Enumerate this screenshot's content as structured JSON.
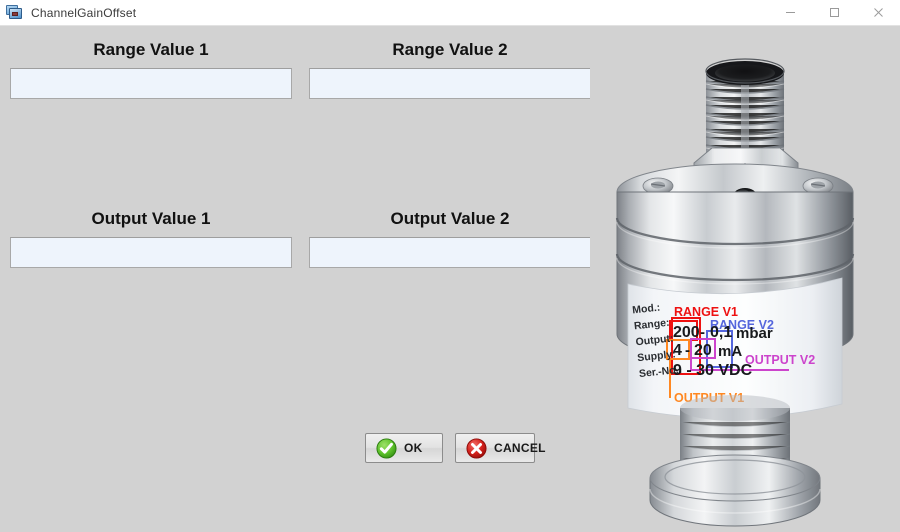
{
  "window": {
    "title": "ChannelGainOffset",
    "icon": "computer-monitor-icon",
    "minimize_label": "Minimize",
    "maximize_label": "Maximize",
    "close_label": "Close"
  },
  "form": {
    "fields": [
      {
        "label": "Range Value 1",
        "value": "",
        "placeholder": ""
      },
      {
        "label": "Range Value 2",
        "value": "",
        "placeholder": ""
      },
      {
        "label": "Output Value 1",
        "value": "",
        "placeholder": ""
      },
      {
        "label": "Output Value 2",
        "value": "",
        "placeholder": ""
      }
    ]
  },
  "buttons": {
    "ok": "OK",
    "cancel": "CANCEL"
  },
  "sensor_label": {
    "rows": [
      {
        "key": "Mod.:",
        "value": ""
      },
      {
        "key": "Range:",
        "value": "200 - 0,1 mbar"
      },
      {
        "key": "Output:",
        "value": "4 - 20 mA"
      },
      {
        "key": "Supply:",
        "value": "9 - 30 VDC"
      },
      {
        "key": "Ser.-No.:",
        "value": ""
      }
    ],
    "range_v1_value": "200",
    "range_v2_value": "0,1",
    "range_unit": "mbar",
    "output_v1_value": "4",
    "output_v2_value": "20",
    "output_unit": "mA",
    "supply_value": "9 - 30 VDC",
    "separator": "-",
    "annotations": [
      {
        "name": "RANGE V1",
        "color": "#ee1111"
      },
      {
        "name": "RANGE V2",
        "color": "#5566dd"
      },
      {
        "name": "OUTPUT V1",
        "color": "#ff8822"
      },
      {
        "name": "OUTPUT V2",
        "color": "#cc44cc"
      }
    ]
  },
  "colors": {
    "window_bg": "#d2d2d2",
    "titlebar_bg": "#ffffff",
    "input_bg": "#eef4fc",
    "input_border": "#a8a8a8",
    "label_text": "#111111",
    "ok_green": "#4caf23",
    "cancel_red": "#cc1a1a",
    "range_v1": "#ee1111",
    "range_v2": "#5566dd",
    "output_v1": "#ff8822",
    "output_v2": "#cc44cc"
  }
}
